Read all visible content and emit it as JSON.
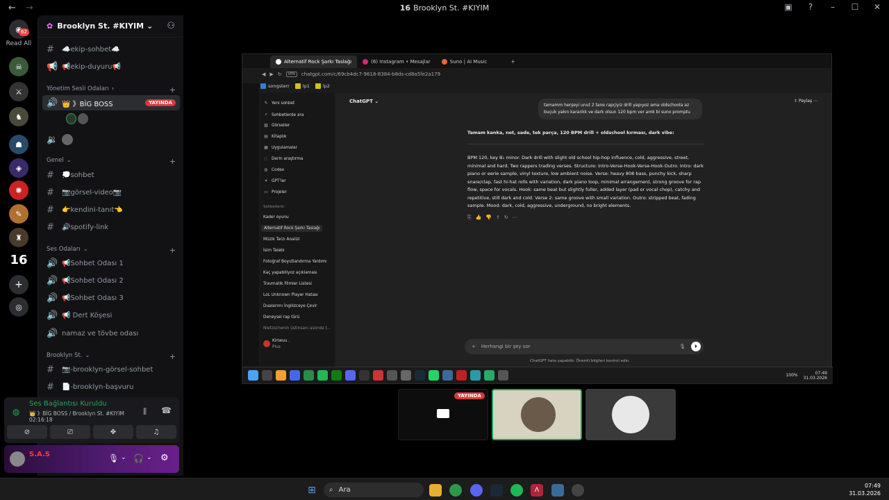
{
  "window": {
    "title": "Brooklyn St. #KIYIM",
    "title_prefix": "16"
  },
  "servers": {
    "read_all": "Read All",
    "badge": "62"
  },
  "guild": {
    "name": "Brooklyn St. #KIYIM"
  },
  "channels": {
    "top": [
      "☁️ekip-sohbet☁️",
      "📢ekip-duyuru📢"
    ],
    "yonetim": "Yönetim Sesli Odaları",
    "big_boss": "👑 》BİG BOSS",
    "live": "YAYINDA",
    "genel": "Genel",
    "genel_items": [
      "💭sohbet",
      "📷görsel-video📷",
      "👉kendini-tanıt👈",
      "🔊spotify-link"
    ],
    "ses": "Ses Odaları",
    "ses_items": [
      "📢Sohbet Odası 1",
      "📢Sohbet Odası 2",
      "📢Sohbet Odası 3",
      "📢 Dert Köşesi",
      "namaz ve tövbe odası"
    ],
    "brooklyn": "Brooklyn St.",
    "brooklyn_items": [
      "📷-brooklyn-görsel-sohbet",
      "📄-brooklyn-başvuru"
    ]
  },
  "voice": {
    "status": "Ses Bağlantısı Kuruldu",
    "sub": "👑 》BİG BOSS / Brooklyn St. #KIYIM",
    "time": "02:16:18"
  },
  "user": {
    "name": "S.A.S"
  },
  "browser": {
    "tabs": [
      "Alternatif Rock Şarkı Taslağı",
      "(6) Instagram • Mesajlar",
      "Suno | AI Music"
    ],
    "url": "chatgpt.com/c/69cb4dc7-9618-8384-b8ds-cd8a5fe2a179",
    "vpn": "VPN",
    "bookmarks": [
      "songsterr",
      "lp1",
      "lp2"
    ]
  },
  "chatgpt": {
    "brand": "ChatGPT",
    "share": "Paylaş",
    "menu": [
      "Yeni sohbet",
      "Sohbetlerde ara",
      "Görseller",
      "Kitaplık",
      "Uygulamalar",
      "Derin araştırma",
      "Codex",
      "GPT'ler",
      "Projeler"
    ],
    "section": "Sohbetlerin",
    "history": [
      "Kader oyunu",
      "Alternatif Rock Şarkı Taslağı",
      "Müzik Tarzı Analizi",
      "İsim Talebi",
      "Fotoğraf Boyutlandırma Yardımı",
      "Kaç yapabiliyoz açıklaması",
      "Travmatik Filmler Listesi",
      "LoL Unknown Player Hatası",
      "Dualarımı İngilizceye Çevir",
      "Deneysel rap türü",
      "Nietzschenin üstinsanı aslında t..."
    ],
    "account": "Kiriwuu .",
    "plan": "Plus",
    "user_msg": "tamamm herşeyi unut 2 tane rapçiyiz drill yapıyoz ama oldschoola az buçuk yakın karanlık ve dark olsun 120 bpm ver amk bi suno promptu",
    "reply_intro": "Tamam kanka, net, sade, tek parça, 120 BPM drill + oldschool kırması, dark vibe:",
    "reply_body": "BPM 120, key B♭ minor. Dark drill with slight old school hip-hop influence, cold, aggressive, street, minimal and hard. Two rappers trading verses. Structure: Intro-Verse-Hook-Verse-Hook-Outro. Intro: dark piano or eerie sample, vinyl texture, low ambient noise. Verse: heavy 808 bass, punchy kick, sharp snare/clap, fast hi-hat rolls with variation, dark piano loop, minimal arrangement, strong groove for rap flow, space for vocals. Hook: same beat but slightly fuller, added layer (pad or vocal chop), catchy and repetitive, still dark and cold. Verse 2: same groove with small variation. Outro: stripped beat, fading sample. Mood: dark, cold, aggressive, underground, no bright elements.",
    "placeholder": "Herhangi bir şey sor",
    "disclaimer": "ChatGPT hata yapabilir. Önemli bilgileri kontrol edin.",
    "tray": {
      "battery": "100%",
      "time": "07:49",
      "date": "31.03.2026"
    }
  },
  "stage": {
    "live": "YAYINDA"
  },
  "taskbar": {
    "search": "Ara",
    "time": "07:49",
    "date": "31.03.2026"
  }
}
